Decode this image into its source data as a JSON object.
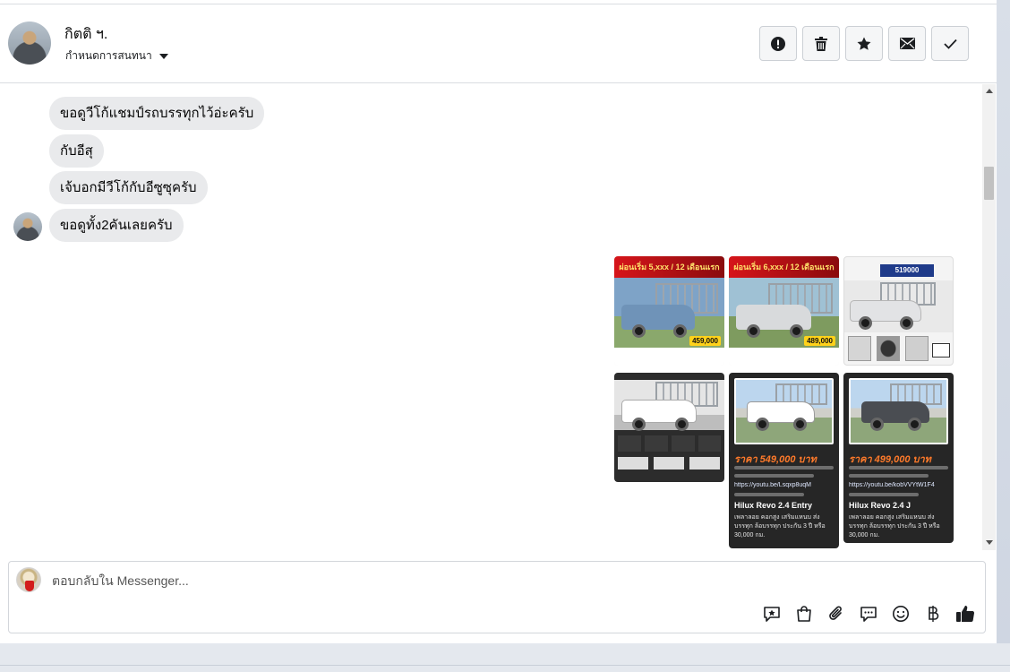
{
  "header": {
    "contact_name": "กิตติ ฯ.",
    "conversation_settings": "กำหนดการสนทนา",
    "actions": [
      {
        "name": "mark-spam",
        "icon": "exclamation-circle-icon"
      },
      {
        "name": "delete",
        "icon": "trash-icon"
      },
      {
        "name": "star",
        "icon": "star-icon"
      },
      {
        "name": "mark-unread",
        "icon": "envelope-icon"
      },
      {
        "name": "mark-done",
        "icon": "checkmark-icon"
      }
    ]
  },
  "messages": [
    {
      "sender": "contact",
      "text": "ขอดูวีโก้แชมป์รถบรรทุกไว้อ่ะครับ"
    },
    {
      "sender": "contact",
      "text": "กับอีสุ"
    },
    {
      "sender": "contact",
      "text": "เจ้บอกมีวีโก้กับอีซูซุครับ"
    },
    {
      "sender": "contact",
      "text": "ขอดูทั้ง2คันเลยครับ"
    }
  ],
  "attachments": {
    "row1": [
      {
        "band": "ผ่อนเริ่ม 5,xxx / 12 เดือนแรก",
        "tag": "459,000"
      },
      {
        "band": "ผ่อนเริ่ม 6,xxx / 12 เดือนแรก",
        "tag": "489,000"
      },
      {
        "badge": "519000"
      }
    ],
    "cards": [
      {
        "price": "ราคา 549,000 บาท",
        "link": "https://youtu.be/Lsqxp8uqM",
        "model": "Hilux Revo 2.4 Entry",
        "desc": "เพลาลอย คอกสูง เสริมแหนบ ส่ง บรรทุก ล้อบรรทุก ประกัน 3 ปี หรือ 30,000 กม."
      },
      {
        "price": "ราคา 499,000 บาท",
        "link": "https://youtu.be/kobVVYtW1F4",
        "model": "Hilux Revo 2.4 J",
        "desc": "เพลาลอย คอกสูง เสริมแหนบ ส่ง บรรทุก ล้อบรรทุก ประกัน 3 ปี หรือ 30,000 กม."
      }
    ]
  },
  "composer": {
    "placeholder": "ตอบกลับใน Messenger...",
    "icons": [
      "saved-reply-icon",
      "shop-bag-icon",
      "paperclip-icon",
      "chat-bubbles-icon",
      "emoji-icon",
      "baht-icon",
      "thumbs-up-icon"
    ]
  },
  "colors": {
    "accent": "#1877f2",
    "bubble": "#e9eaec"
  }
}
